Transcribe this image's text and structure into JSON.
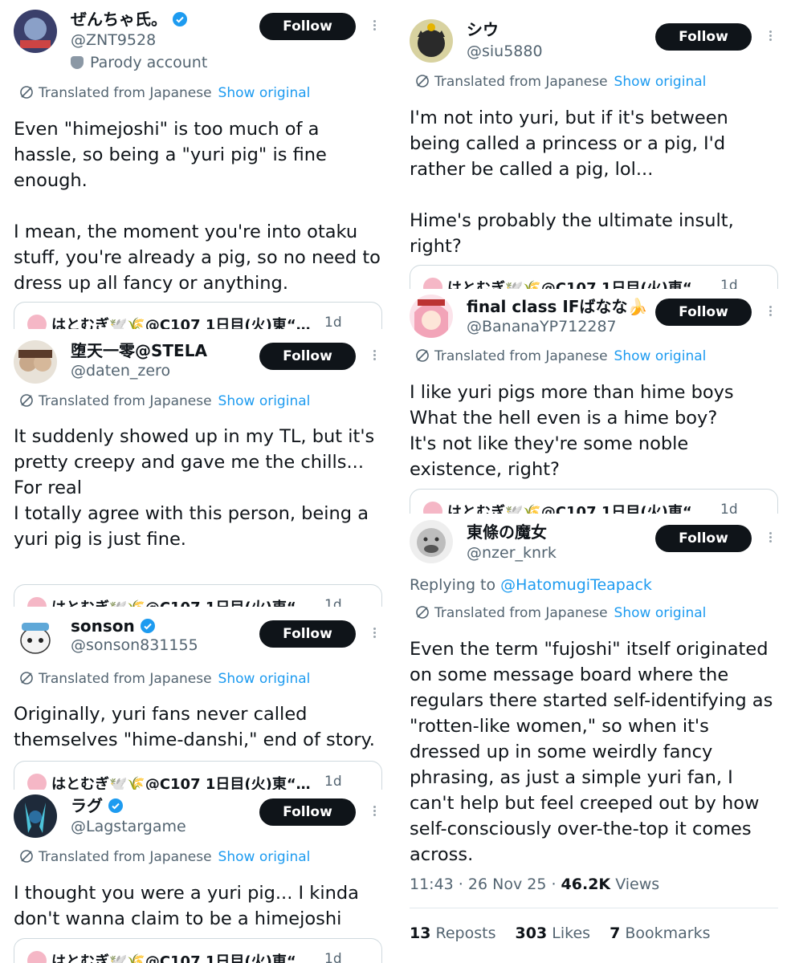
{
  "common": {
    "follow_label": "Follow",
    "translated_label": "Translated from Japanese",
    "show_original_label": "Show original",
    "accent_color": "#1d9bf0",
    "quote": {
      "author": "はとむぎ🕊️🌾@C107 1日目(火)東“…",
      "time": "1d"
    }
  },
  "left": [
    {
      "name": "ぜんちゃ氏。",
      "verified": true,
      "handle": "@ZNT9528",
      "parody_label": "Parody account",
      "text": "Even \"himejoshi\" is too much of a hassle, so being a \"yuri pig\" is fine enough.\n\nI mean, the moment you're into otaku stuff, you're already a pig, so no need to dress up all fancy or anything."
    },
    {
      "name": "堕天一零@STELA",
      "verified": false,
      "handle": "@daten_zero",
      "text": "It suddenly showed up in my TL, but it's pretty creepy and gave me the chills...\nFor real\nI totally agree with this person, being a yuri pig is just fine."
    },
    {
      "name": "sonson",
      "verified": true,
      "handle": "@sonson831155",
      "text": "Originally, yuri fans never called themselves \"hime-danshi,\" end of story."
    },
    {
      "name": "ラグ",
      "verified": true,
      "handle": "@Lagstargame",
      "text": "I thought you were a yuri pig... I kinda don't wanna claim to be a himejoshi"
    }
  ],
  "right": [
    {
      "name": "シウ",
      "verified": false,
      "handle": "@siu5880",
      "text": "I'm not into yuri, but if it's between being called a princess or a pig, I'd rather be called a pig, lol...\n\nHime's probably the ultimate insult, right?"
    },
    {
      "name": "final class IFばなな🍌",
      "verified": false,
      "handle": "@BananaYP712287",
      "text": "I like yuri pigs more than hime boys\nWhat the hell even is a hime boy?\nIt's not like they're some noble existence, right?"
    },
    {
      "name": "東條の魔女",
      "verified": false,
      "handle": "@nzer_knrk",
      "replying_prefix": "Replying to",
      "replying_to": "@HatomugiTeapack",
      "text": "Even the term \"fujoshi\" itself originated on some message board where the regulars there started self-identifying as \"rotten-like women,\" so when it's dressed up in some weirdly fancy phrasing, as just a simple yuri fan, I can't help but feel creeped out by how self-consciously over-the-top it comes across.",
      "meta": {
        "time": "11:43",
        "date": "26 Nov 25",
        "views": "46.2K",
        "views_label": "Views"
      },
      "stats": {
        "reposts": "13",
        "reposts_label": "Reposts",
        "likes": "303",
        "likes_label": "Likes",
        "bookmarks": "7",
        "bookmarks_label": "Bookmarks"
      }
    }
  ]
}
